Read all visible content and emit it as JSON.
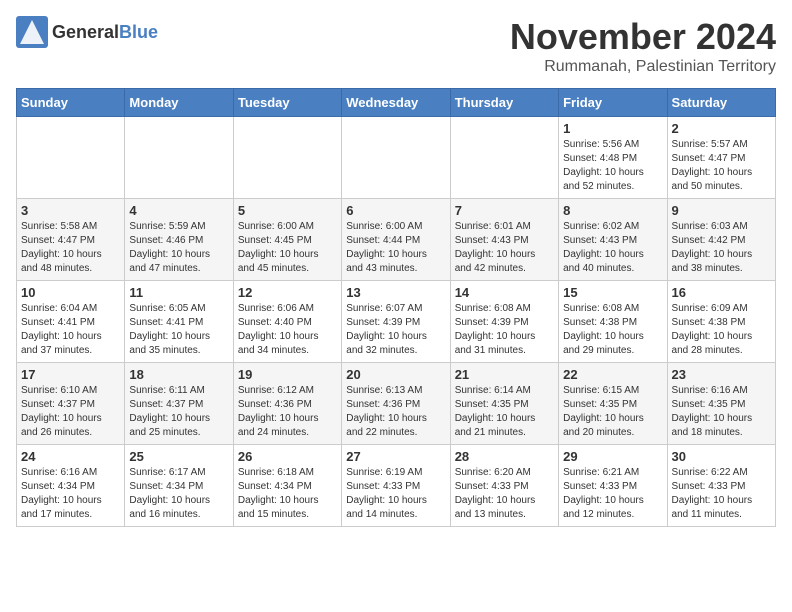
{
  "header": {
    "logo_general": "General",
    "logo_blue": "Blue",
    "month_title": "November 2024",
    "location": "Rummanah, Palestinian Territory"
  },
  "weekdays": [
    "Sunday",
    "Monday",
    "Tuesday",
    "Wednesday",
    "Thursday",
    "Friday",
    "Saturday"
  ],
  "weeks": [
    [
      {
        "day": "",
        "sunrise": "",
        "sunset": "",
        "daylight": ""
      },
      {
        "day": "",
        "sunrise": "",
        "sunset": "",
        "daylight": ""
      },
      {
        "day": "",
        "sunrise": "",
        "sunset": "",
        "daylight": ""
      },
      {
        "day": "",
        "sunrise": "",
        "sunset": "",
        "daylight": ""
      },
      {
        "day": "",
        "sunrise": "",
        "sunset": "",
        "daylight": ""
      },
      {
        "day": "1",
        "sunrise": "Sunrise: 5:56 AM",
        "sunset": "Sunset: 4:48 PM",
        "daylight": "Daylight: 10 hours and 52 minutes."
      },
      {
        "day": "2",
        "sunrise": "Sunrise: 5:57 AM",
        "sunset": "Sunset: 4:47 PM",
        "daylight": "Daylight: 10 hours and 50 minutes."
      }
    ],
    [
      {
        "day": "3",
        "sunrise": "Sunrise: 5:58 AM",
        "sunset": "Sunset: 4:47 PM",
        "daylight": "Daylight: 10 hours and 48 minutes."
      },
      {
        "day": "4",
        "sunrise": "Sunrise: 5:59 AM",
        "sunset": "Sunset: 4:46 PM",
        "daylight": "Daylight: 10 hours and 47 minutes."
      },
      {
        "day": "5",
        "sunrise": "Sunrise: 6:00 AM",
        "sunset": "Sunset: 4:45 PM",
        "daylight": "Daylight: 10 hours and 45 minutes."
      },
      {
        "day": "6",
        "sunrise": "Sunrise: 6:00 AM",
        "sunset": "Sunset: 4:44 PM",
        "daylight": "Daylight: 10 hours and 43 minutes."
      },
      {
        "day": "7",
        "sunrise": "Sunrise: 6:01 AM",
        "sunset": "Sunset: 4:43 PM",
        "daylight": "Daylight: 10 hours and 42 minutes."
      },
      {
        "day": "8",
        "sunrise": "Sunrise: 6:02 AM",
        "sunset": "Sunset: 4:43 PM",
        "daylight": "Daylight: 10 hours and 40 minutes."
      },
      {
        "day": "9",
        "sunrise": "Sunrise: 6:03 AM",
        "sunset": "Sunset: 4:42 PM",
        "daylight": "Daylight: 10 hours and 38 minutes."
      }
    ],
    [
      {
        "day": "10",
        "sunrise": "Sunrise: 6:04 AM",
        "sunset": "Sunset: 4:41 PM",
        "daylight": "Daylight: 10 hours and 37 minutes."
      },
      {
        "day": "11",
        "sunrise": "Sunrise: 6:05 AM",
        "sunset": "Sunset: 4:41 PM",
        "daylight": "Daylight: 10 hours and 35 minutes."
      },
      {
        "day": "12",
        "sunrise": "Sunrise: 6:06 AM",
        "sunset": "Sunset: 4:40 PM",
        "daylight": "Daylight: 10 hours and 34 minutes."
      },
      {
        "day": "13",
        "sunrise": "Sunrise: 6:07 AM",
        "sunset": "Sunset: 4:39 PM",
        "daylight": "Daylight: 10 hours and 32 minutes."
      },
      {
        "day": "14",
        "sunrise": "Sunrise: 6:08 AM",
        "sunset": "Sunset: 4:39 PM",
        "daylight": "Daylight: 10 hours and 31 minutes."
      },
      {
        "day": "15",
        "sunrise": "Sunrise: 6:08 AM",
        "sunset": "Sunset: 4:38 PM",
        "daylight": "Daylight: 10 hours and 29 minutes."
      },
      {
        "day": "16",
        "sunrise": "Sunrise: 6:09 AM",
        "sunset": "Sunset: 4:38 PM",
        "daylight": "Daylight: 10 hours and 28 minutes."
      }
    ],
    [
      {
        "day": "17",
        "sunrise": "Sunrise: 6:10 AM",
        "sunset": "Sunset: 4:37 PM",
        "daylight": "Daylight: 10 hours and 26 minutes."
      },
      {
        "day": "18",
        "sunrise": "Sunrise: 6:11 AM",
        "sunset": "Sunset: 4:37 PM",
        "daylight": "Daylight: 10 hours and 25 minutes."
      },
      {
        "day": "19",
        "sunrise": "Sunrise: 6:12 AM",
        "sunset": "Sunset: 4:36 PM",
        "daylight": "Daylight: 10 hours and 24 minutes."
      },
      {
        "day": "20",
        "sunrise": "Sunrise: 6:13 AM",
        "sunset": "Sunset: 4:36 PM",
        "daylight": "Daylight: 10 hours and 22 minutes."
      },
      {
        "day": "21",
        "sunrise": "Sunrise: 6:14 AM",
        "sunset": "Sunset: 4:35 PM",
        "daylight": "Daylight: 10 hours and 21 minutes."
      },
      {
        "day": "22",
        "sunrise": "Sunrise: 6:15 AM",
        "sunset": "Sunset: 4:35 PM",
        "daylight": "Daylight: 10 hours and 20 minutes."
      },
      {
        "day": "23",
        "sunrise": "Sunrise: 6:16 AM",
        "sunset": "Sunset: 4:35 PM",
        "daylight": "Daylight: 10 hours and 18 minutes."
      }
    ],
    [
      {
        "day": "24",
        "sunrise": "Sunrise: 6:16 AM",
        "sunset": "Sunset: 4:34 PM",
        "daylight": "Daylight: 10 hours and 17 minutes."
      },
      {
        "day": "25",
        "sunrise": "Sunrise: 6:17 AM",
        "sunset": "Sunset: 4:34 PM",
        "daylight": "Daylight: 10 hours and 16 minutes."
      },
      {
        "day": "26",
        "sunrise": "Sunrise: 6:18 AM",
        "sunset": "Sunset: 4:34 PM",
        "daylight": "Daylight: 10 hours and 15 minutes."
      },
      {
        "day": "27",
        "sunrise": "Sunrise: 6:19 AM",
        "sunset": "Sunset: 4:33 PM",
        "daylight": "Daylight: 10 hours and 14 minutes."
      },
      {
        "day": "28",
        "sunrise": "Sunrise: 6:20 AM",
        "sunset": "Sunset: 4:33 PM",
        "daylight": "Daylight: 10 hours and 13 minutes."
      },
      {
        "day": "29",
        "sunrise": "Sunrise: 6:21 AM",
        "sunset": "Sunset: 4:33 PM",
        "daylight": "Daylight: 10 hours and 12 minutes."
      },
      {
        "day": "30",
        "sunrise": "Sunrise: 6:22 AM",
        "sunset": "Sunset: 4:33 PM",
        "daylight": "Daylight: 10 hours and 11 minutes."
      }
    ]
  ]
}
